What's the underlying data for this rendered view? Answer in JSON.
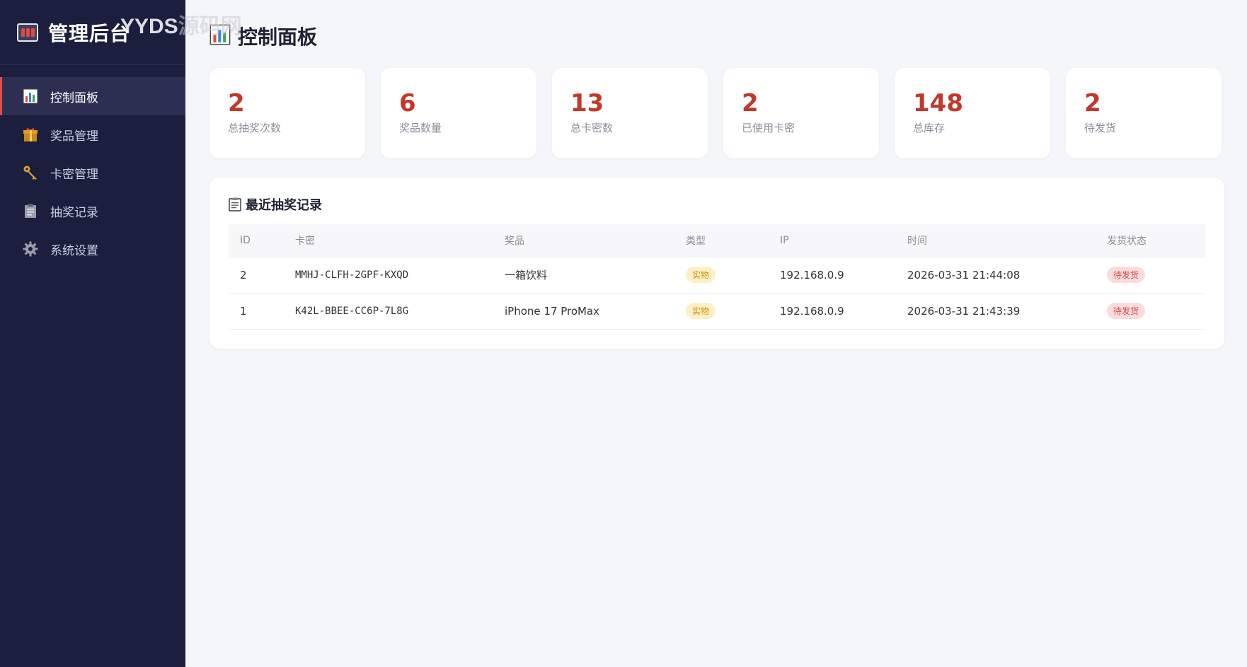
{
  "brand": {
    "title": "管理后台",
    "watermark_a": "YYDS",
    "watermark_b": "源码网"
  },
  "sidebar": {
    "items": [
      {
        "label": "控制面板",
        "icon": "bar-chart-icon",
        "active": true
      },
      {
        "label": "奖品管理",
        "icon": "gift-icon",
        "active": false
      },
      {
        "label": "卡密管理",
        "icon": "key-icon",
        "active": false
      },
      {
        "label": "抽奖记录",
        "icon": "clipboard-icon",
        "active": false
      },
      {
        "label": "系统设置",
        "icon": "gear-icon",
        "active": false
      }
    ]
  },
  "page": {
    "title": "控制面板"
  },
  "stats": [
    {
      "value": "2",
      "label": "总抽奖次数"
    },
    {
      "value": "6",
      "label": "奖品数量"
    },
    {
      "value": "13",
      "label": "总卡密数"
    },
    {
      "value": "2",
      "label": "已使用卡密"
    },
    {
      "value": "148",
      "label": "总库存"
    },
    {
      "value": "2",
      "label": "待发货"
    }
  ],
  "records": {
    "title": "最近抽奖记录",
    "columns": [
      "ID",
      "卡密",
      "奖品",
      "类型",
      "IP",
      "时间",
      "发货状态"
    ],
    "rows": [
      {
        "id": "2",
        "card": "MMHJ-CLFH-2GPF-KXQD",
        "prize": "一箱饮料",
        "type": "实物",
        "ip": "192.168.0.9",
        "time": "2026-03-31 21:44:08",
        "status": "待发货"
      },
      {
        "id": "1",
        "card": "K42L-BBEE-CC6P-7L8G",
        "prize": "iPhone 17 ProMax",
        "type": "实物",
        "ip": "192.168.0.9",
        "time": "2026-03-31 21:43:39",
        "status": "待发货"
      }
    ]
  },
  "colors": {
    "sidebar_bg": "#1b1e3d",
    "accent": "#c0392b",
    "page_bg": "#f5f6fa"
  }
}
